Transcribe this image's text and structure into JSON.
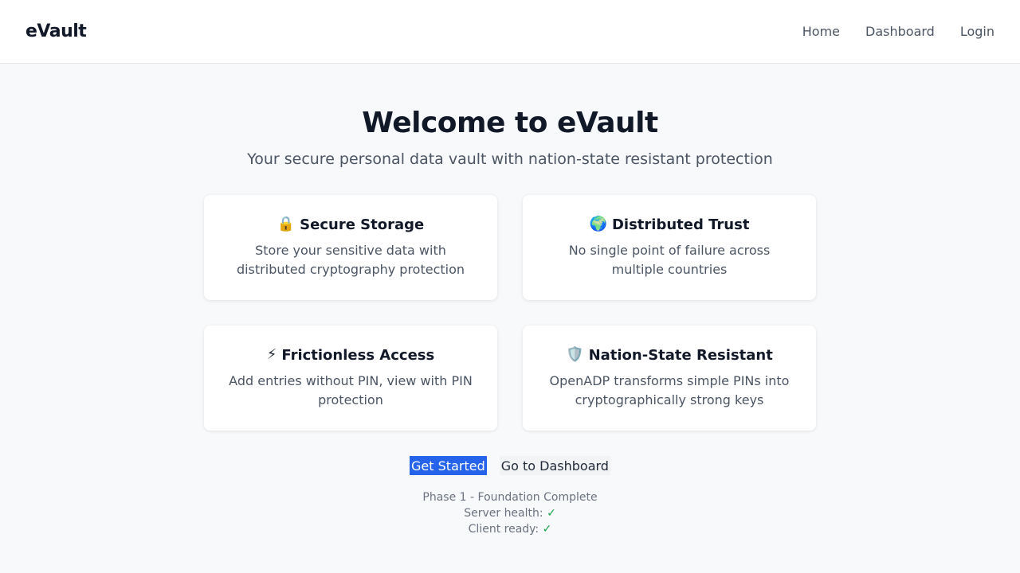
{
  "navbar": {
    "brand": "eVault",
    "links": [
      "Home",
      "Dashboard",
      "Login"
    ]
  },
  "hero": {
    "title": "Welcome to eVault",
    "subtitle": "Your secure personal data vault with nation-state resistant protection"
  },
  "features": [
    {
      "icon": "lock-icon",
      "glyph": "🔒",
      "title": "Secure Storage",
      "description": "Store your sensitive data with distributed cryptography protection"
    },
    {
      "icon": "globe-icon",
      "glyph": "🌍",
      "title": "Distributed Trust",
      "description": "No single point of failure across multiple countries"
    },
    {
      "icon": "lightning-icon",
      "glyph": "⚡",
      "title": "Frictionless Access",
      "description": "Add entries without PIN, view with PIN protection"
    },
    {
      "icon": "shield-icon",
      "glyph": "🛡️",
      "title": "Nation-State Resistant",
      "description": "OpenADP transforms simple PINs into cryptographically strong keys"
    }
  ],
  "actions": {
    "primary": "Get Started",
    "secondary": "Go to Dashboard"
  },
  "status": {
    "phase": "Phase 1 - Foundation Complete",
    "server_label": "Server health:",
    "server_value": "✓",
    "client_label": "Client ready:",
    "client_value": "✓"
  },
  "colors": {
    "primary": "#2563eb",
    "success": "#16a34a"
  }
}
